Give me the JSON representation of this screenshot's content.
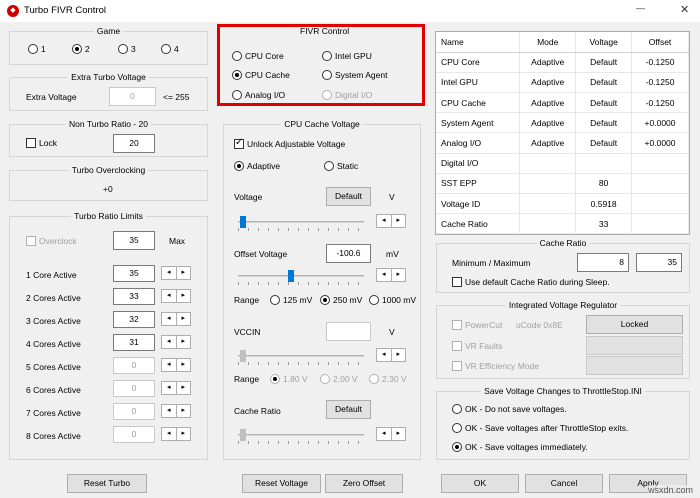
{
  "window": {
    "title": "Turbo FIVR Control",
    "minimize_icon": "minimize-icon",
    "close_icon": "close-icon",
    "close_glyph": "✕",
    "minimize_glyph": "—"
  },
  "game": {
    "title": "Game",
    "options": [
      "1",
      "2",
      "3",
      "4"
    ],
    "selected": "2"
  },
  "extra_turbo": {
    "title": "Extra Turbo Voltage",
    "label": "Extra Voltage",
    "value": "0",
    "suffix": "<= 255"
  },
  "non_turbo": {
    "title": "Non Turbo Ratio - 20",
    "lock_label": "Lock",
    "value": "20"
  },
  "turbo_overclocking": {
    "title": "Turbo Overclocking",
    "value": "+0"
  },
  "turbo_ratio": {
    "title": "Turbo Ratio Limits",
    "overclock_label": "Overclock",
    "overclock_value": "35",
    "max_label": "Max",
    "rows": [
      {
        "label": "1 Core Active",
        "value": "35"
      },
      {
        "label": "2 Cores Active",
        "value": "33"
      },
      {
        "label": "3 Cores Active",
        "value": "32"
      },
      {
        "label": "4 Cores Active",
        "value": "31"
      },
      {
        "label": "5 Cores Active",
        "value": "0"
      },
      {
        "label": "6 Cores Active",
        "value": "0"
      },
      {
        "label": "7 Cores Active",
        "value": "0"
      },
      {
        "label": "8 Cores Active",
        "value": "0"
      }
    ]
  },
  "fivr": {
    "title": "FIVR Control",
    "options": [
      "CPU Core",
      "Intel GPU",
      "CPU Cache",
      "System Agent",
      "Analog I/O",
      "Digital I/O"
    ],
    "selected": "CPU Cache"
  },
  "cache_voltage": {
    "title": "CPU Cache Voltage",
    "unlock_label": "Unlock Adjustable Voltage",
    "adaptive_label": "Adaptive",
    "static_label": "Static",
    "voltage_label": "Voltage",
    "voltage_value": "Default",
    "voltage_unit": "V",
    "offset_label": "Offset Voltage",
    "offset_value": "-100.6",
    "offset_unit": "mV",
    "range_label": "Range",
    "ranges": [
      "125 mV",
      "250 mV",
      "1000 mV"
    ],
    "range_selected": "250 mV",
    "vccin_label": "VCCIN",
    "vccin_value": "",
    "vccin_unit": "V",
    "vccin_range_label": "Range",
    "vccin_ranges": [
      "1.80 V",
      "2.00 V",
      "2.30 V"
    ],
    "cache_ratio_label": "Cache Ratio",
    "cache_ratio_value": "Default",
    "voltage_level": 0.0,
    "offset_level": 0.4
  },
  "table": {
    "headers": [
      "Name",
      "Mode",
      "Voltage",
      "Offset"
    ],
    "rows": [
      [
        "CPU Core",
        "Adaptive",
        "Default",
        "-0.1250"
      ],
      [
        "Intel GPU",
        "Adaptive",
        "Default",
        "-0.1250"
      ],
      [
        "CPU Cache",
        "Adaptive",
        "Default",
        "-0.1250"
      ],
      [
        "System Agent",
        "Adaptive",
        "Default",
        "+0.0000"
      ],
      [
        "Analog I/O",
        "Adaptive",
        "Default",
        "+0.0000"
      ],
      [
        "Digital I/O",
        "",
        "",
        ""
      ],
      [
        "SST EPP",
        "",
        "80",
        ""
      ],
      [
        "Voltage ID",
        "",
        "0.5918",
        ""
      ],
      [
        "Cache Ratio",
        "",
        "33",
        ""
      ]
    ]
  },
  "cache_ratio": {
    "title": "Cache Ratio",
    "label": "Minimum / Maximum",
    "min": "8",
    "max": "35",
    "default_label": "Use default Cache Ratio during Sleep."
  },
  "ivr": {
    "title": "Integrated Voltage Regulator",
    "powercut_label": "PowerCut",
    "ucode_label": "uCode 0x8E",
    "locked_label": "Locked",
    "vr_faults_label": "VR Faults",
    "vr_eff_label": "VR Efficiency Mode"
  },
  "save": {
    "title": "Save Voltage Changes to ThrottleStop.INI",
    "options": [
      "OK - Do not save voltages.",
      "OK - Save voltages after ThrottleStop exits.",
      "OK - Save voltages immediately."
    ],
    "selected": 2
  },
  "buttons": {
    "reset_turbo": "Reset Turbo",
    "reset_voltage": "Reset Voltage",
    "zero_offset": "Zero Offset",
    "ok": "OK",
    "cancel": "Cancel",
    "apply": "Apply"
  },
  "spin": {
    "left": "◂",
    "right": "▸"
  },
  "colors": {
    "highlight_border": "#e00000",
    "accent": "#0078d7"
  },
  "watermark": "wsxdn.com"
}
